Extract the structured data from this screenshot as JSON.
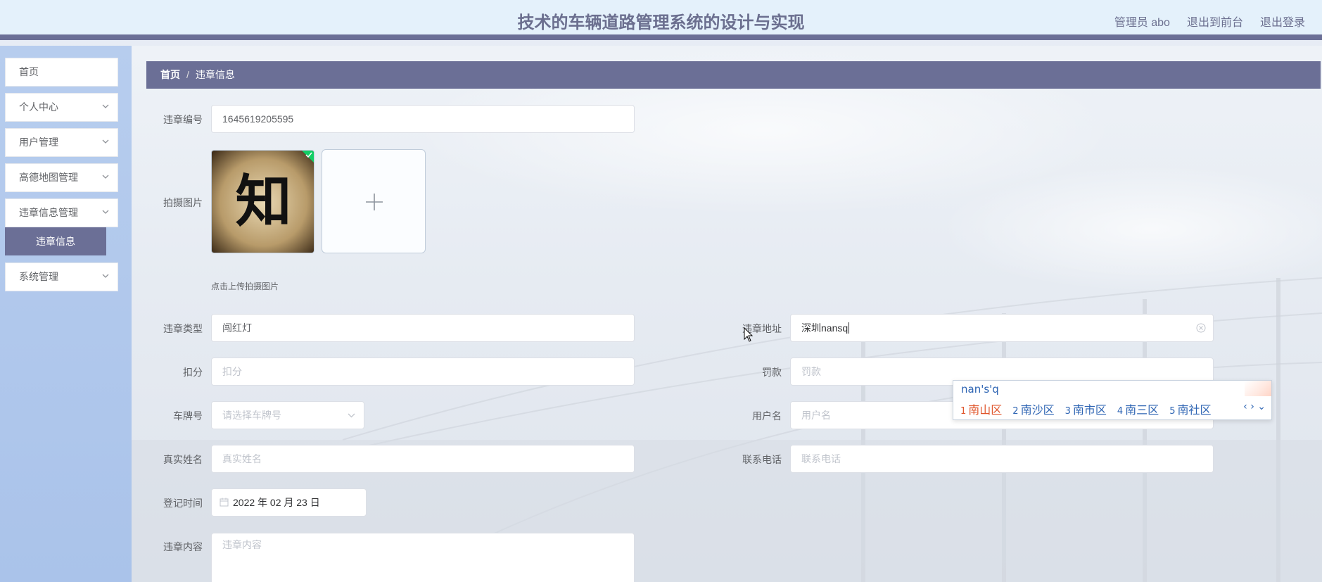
{
  "header": {
    "title": "技术的车辆道路管理系统的设计与实现",
    "admin": "管理员 abo",
    "exit_front": "退出到前台",
    "logout": "退出登录"
  },
  "sidebar": {
    "items": [
      {
        "label": "首页"
      },
      {
        "label": "个人中心"
      },
      {
        "label": "用户管理"
      },
      {
        "label": "高德地图管理"
      },
      {
        "label": "违章信息管理"
      },
      {
        "label": "系统管理"
      }
    ],
    "sub_active": "违章信息"
  },
  "breadcrumb": {
    "home": "首页",
    "sep": "/",
    "current": "违章信息"
  },
  "form": {
    "violation_no": {
      "label": "违章编号",
      "value": "1645619205595"
    },
    "photo": {
      "label": "拍摄图片",
      "glyph": "知",
      "tip": "点击上传拍摄图片"
    },
    "violation_type": {
      "label": "违章类型",
      "value": "闯红灯"
    },
    "violation_addr": {
      "label": "违章地址",
      "value": "深圳nansq"
    },
    "points": {
      "label": "扣分",
      "placeholder": "扣分"
    },
    "fine": {
      "label": "罚款",
      "placeholder": "罚款"
    },
    "plate": {
      "label": "车牌号",
      "placeholder": "请选择车牌号"
    },
    "username": {
      "label": "用户名",
      "placeholder": "用户名"
    },
    "realname": {
      "label": "真实姓名",
      "placeholder": "真实姓名"
    },
    "phone": {
      "label": "联系电话",
      "placeholder": "联系电话"
    },
    "reg_time": {
      "label": "登记时间",
      "value": "2022 年 02 月 23 日"
    },
    "content": {
      "label": "违章内容",
      "placeholder": "违章内容"
    }
  },
  "ime": {
    "composition": "nan's'q",
    "candidates": [
      {
        "num": "1",
        "text": "南山区"
      },
      {
        "num": "2",
        "text": "南沙区"
      },
      {
        "num": "3",
        "text": "南市区"
      },
      {
        "num": "4",
        "text": "南三区"
      },
      {
        "num": "5",
        "text": "南社区"
      }
    ],
    "nav": "‹ › ⌄"
  },
  "colors": {
    "accent": "#6b6f96",
    "header_bg": "#e4f1fb",
    "sidebar_bg": "#b0c8ec"
  }
}
